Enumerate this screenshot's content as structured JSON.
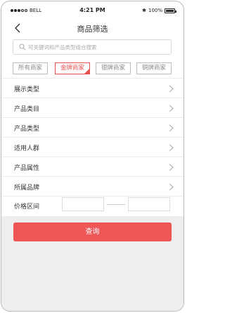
{
  "status_bar": {
    "carrier": "BELL",
    "time": "4:21 PM",
    "battery": "100%"
  },
  "header": {
    "title": "商品筛选"
  },
  "search": {
    "placeholder": "可关键词和产品类型组合搜索"
  },
  "merchant_tiers": [
    {
      "label": "所有商家",
      "selected": false
    },
    {
      "label": "金牌商家",
      "selected": true
    },
    {
      "label": "银牌商家",
      "selected": false
    },
    {
      "label": "铜牌商家",
      "selected": false
    }
  ],
  "filters": [
    {
      "label": "展示类型"
    },
    {
      "label": "产品类目"
    },
    {
      "label": "产品类型"
    },
    {
      "label": "适用人群"
    },
    {
      "label": "产品属性"
    },
    {
      "label": "所属品牌"
    }
  ],
  "price_range": {
    "label": "价格区间",
    "min": "",
    "max": ""
  },
  "query_button": {
    "label": "查询"
  },
  "colors": {
    "accent": "#ef5656",
    "selected_chip": "#e85050"
  }
}
